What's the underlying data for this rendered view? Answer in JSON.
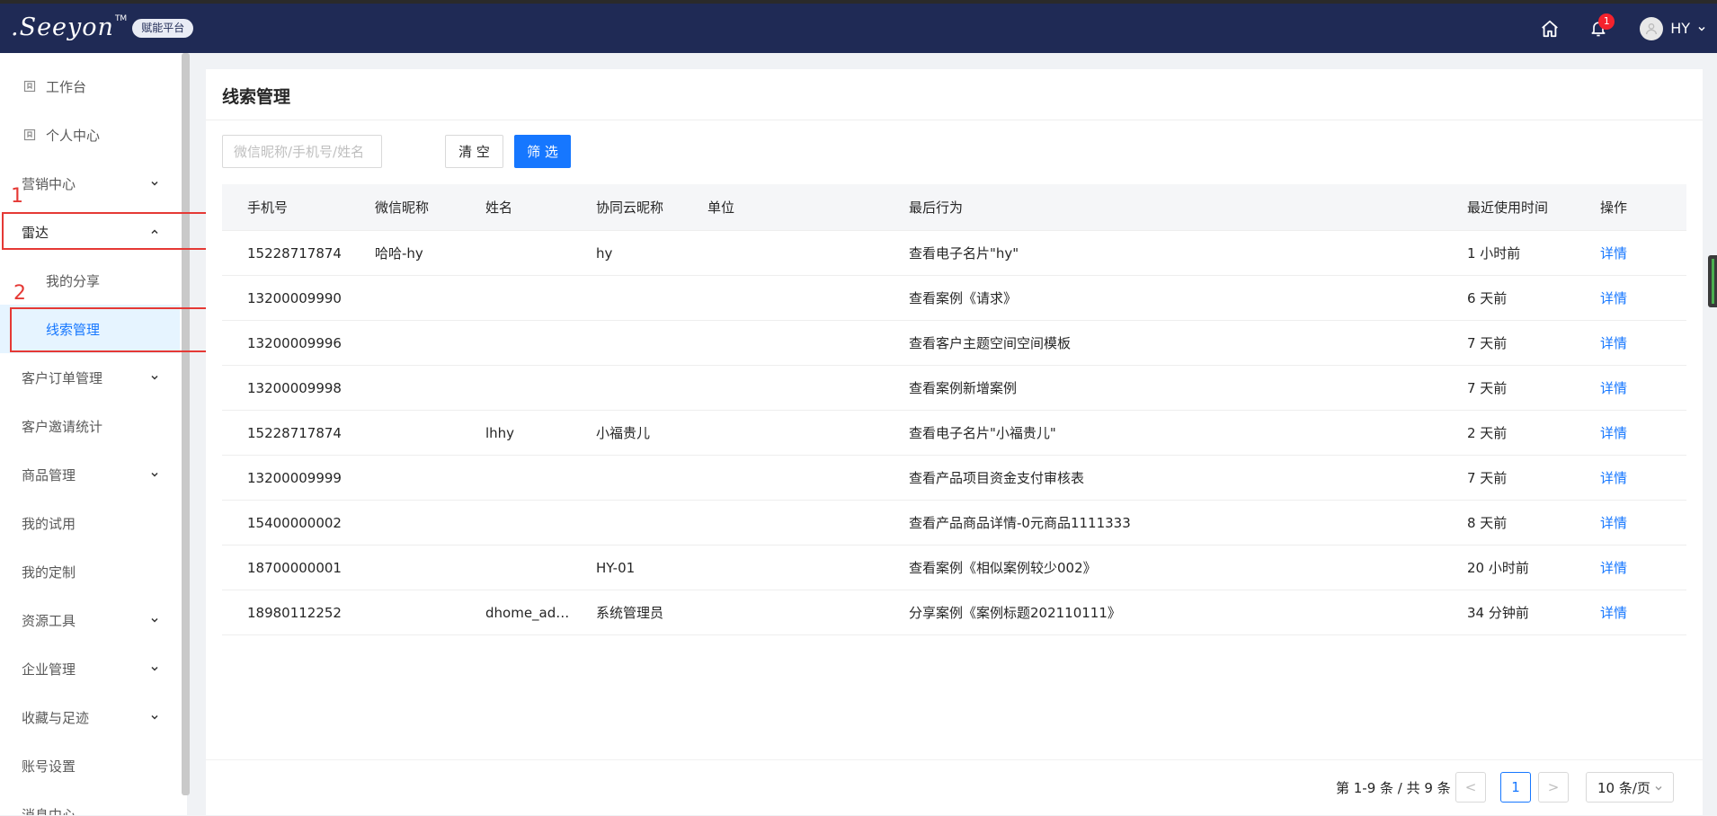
{
  "header": {
    "logo_text": ".Seeyon",
    "logo_tm": "TM",
    "logo_badge": "赋能平台",
    "notification_count": "1",
    "user_name": "HY"
  },
  "sidebar": {
    "items": [
      {
        "label": "工作台"
      },
      {
        "label": "个人中心"
      },
      {
        "label": "营销中心"
      },
      {
        "label": "雷达"
      },
      {
        "label": "我的分享"
      },
      {
        "label": "线索管理"
      },
      {
        "label": "客户订单管理"
      },
      {
        "label": "客户邀请统计"
      },
      {
        "label": "商品管理"
      },
      {
        "label": "我的试用"
      },
      {
        "label": "我的定制"
      },
      {
        "label": "资源工具"
      },
      {
        "label": "企业管理"
      },
      {
        "label": "收藏与足迹"
      },
      {
        "label": "账号设置"
      },
      {
        "label": "消息中心"
      }
    ],
    "annotations": [
      "1",
      "2"
    ]
  },
  "main": {
    "title": "线索管理",
    "search_placeholder": "微信昵称/手机号/姓名",
    "clear_label": "清 空",
    "filter_label": "筛 选"
  },
  "table": {
    "columns": {
      "phone": "手机号",
      "wechat": "微信昵称",
      "name": "姓名",
      "xiety": "协同云昵称",
      "unit": "单位",
      "action": "最后行为",
      "time": "最近使用时间",
      "op": "操作"
    },
    "rows": [
      {
        "phone": "15228717874",
        "wechat": "哈哈-hy",
        "name": "",
        "xiety": "hy",
        "unit": "",
        "action": "查看电子名片\"hy\"",
        "time": "1 小时前",
        "op": "详情"
      },
      {
        "phone": "13200009990",
        "wechat": "",
        "name": "",
        "xiety": "",
        "unit": "",
        "action": "查看案例《请求》",
        "time": "6 天前",
        "op": "详情"
      },
      {
        "phone": "13200009996",
        "wechat": "",
        "name": "",
        "xiety": "",
        "unit": "",
        "action": "查看客户主题空间空间模板",
        "time": "7 天前",
        "op": "详情"
      },
      {
        "phone": "13200009998",
        "wechat": "",
        "name": "",
        "xiety": "",
        "unit": "",
        "action": "查看案例新增案例",
        "time": "7 天前",
        "op": "详情"
      },
      {
        "phone": "15228717874",
        "wechat": "",
        "name": "lhhy",
        "xiety": "小福贵儿",
        "unit": "",
        "action": "查看电子名片\"小福贵儿\"",
        "time": "2 天前",
        "op": "详情"
      },
      {
        "phone": "13200009999",
        "wechat": "",
        "name": "",
        "xiety": "",
        "unit": "",
        "action": "查看产品项目资金支付审核表",
        "time": "7 天前",
        "op": "详情"
      },
      {
        "phone": "15400000002",
        "wechat": "",
        "name": "",
        "xiety": "",
        "unit": "",
        "action": "查看产品商品详情-0元商品1111333",
        "time": "8 天前",
        "op": "详情"
      },
      {
        "phone": "18700000001",
        "wechat": "",
        "name": "",
        "xiety": "HY-01",
        "unit": "",
        "action": "查看案例《相似案例较少002》",
        "time": "20 小时前",
        "op": "详情"
      },
      {
        "phone": "18980112252",
        "wechat": "",
        "name": "dhome_ad…",
        "xiety": "系统管理员",
        "unit": "",
        "action": "分享案例《案例标题202110111》",
        "time": "34 分钟前",
        "op": "详情"
      }
    ]
  },
  "pagination": {
    "total_text": "第 1-9 条 / 共 9 条",
    "prev": "<",
    "current_page": "1",
    "next": ">",
    "page_size": "10 条/页"
  },
  "colors": {
    "header_bg": "#1f2a55",
    "accent": "#1677ff",
    "annotation": "#e53935"
  }
}
